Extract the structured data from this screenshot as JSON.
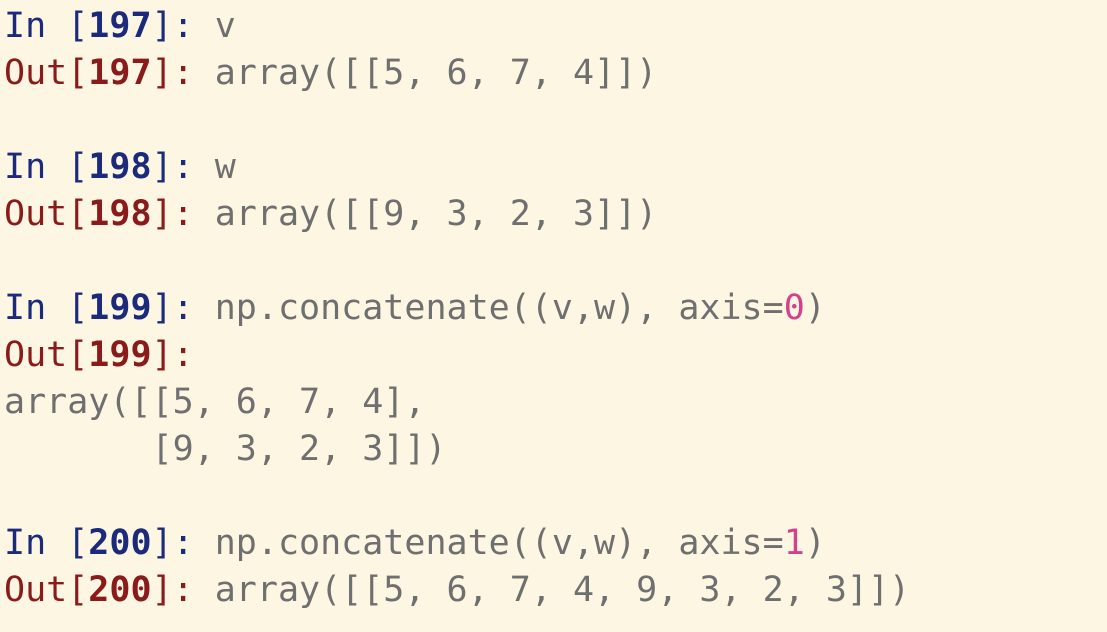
{
  "colors": {
    "background": "#fdf6e3",
    "in_prompt": "#1b2a7a",
    "out_prompt": "#8b1a1a",
    "code_text": "#6f6f6f",
    "number_literal": "#d4408a"
  },
  "cells": [
    {
      "in_label": "In [",
      "in_number": "197",
      "in_close": "]: ",
      "input_code": "v",
      "out_label": "Out[",
      "out_number": "197",
      "out_close": "]: ",
      "output_lines": [
        "array([[5, 6, 7, 4]])"
      ]
    },
    {
      "in_label": "In [",
      "in_number": "198",
      "in_close": "]: ",
      "input_code": "w",
      "out_label": "Out[",
      "out_number": "198",
      "out_close": "]: ",
      "output_lines": [
        "array([[9, 3, 2, 3]])"
      ]
    },
    {
      "in_label": "In [",
      "in_number": "199",
      "in_close": "]: ",
      "input_code_before": "np.concatenate((v,w), axis=",
      "input_literal": "0",
      "input_code_after": ")",
      "out_label": "Out[",
      "out_number": "199",
      "out_close": "]:",
      "output_lines": [
        "array([[5, 6, 7, 4],",
        "       [9, 3, 2, 3]])"
      ]
    },
    {
      "in_label": "In [",
      "in_number": "200",
      "in_close": "]: ",
      "input_code_before": "np.concatenate((v,w), axis=",
      "input_literal": "1",
      "input_code_after": ")",
      "out_label": "Out[",
      "out_number": "200",
      "out_close": "]: ",
      "output_lines": [
        "array([[5, 6, 7, 4, 9, 3, 2, 3]])"
      ]
    }
  ]
}
